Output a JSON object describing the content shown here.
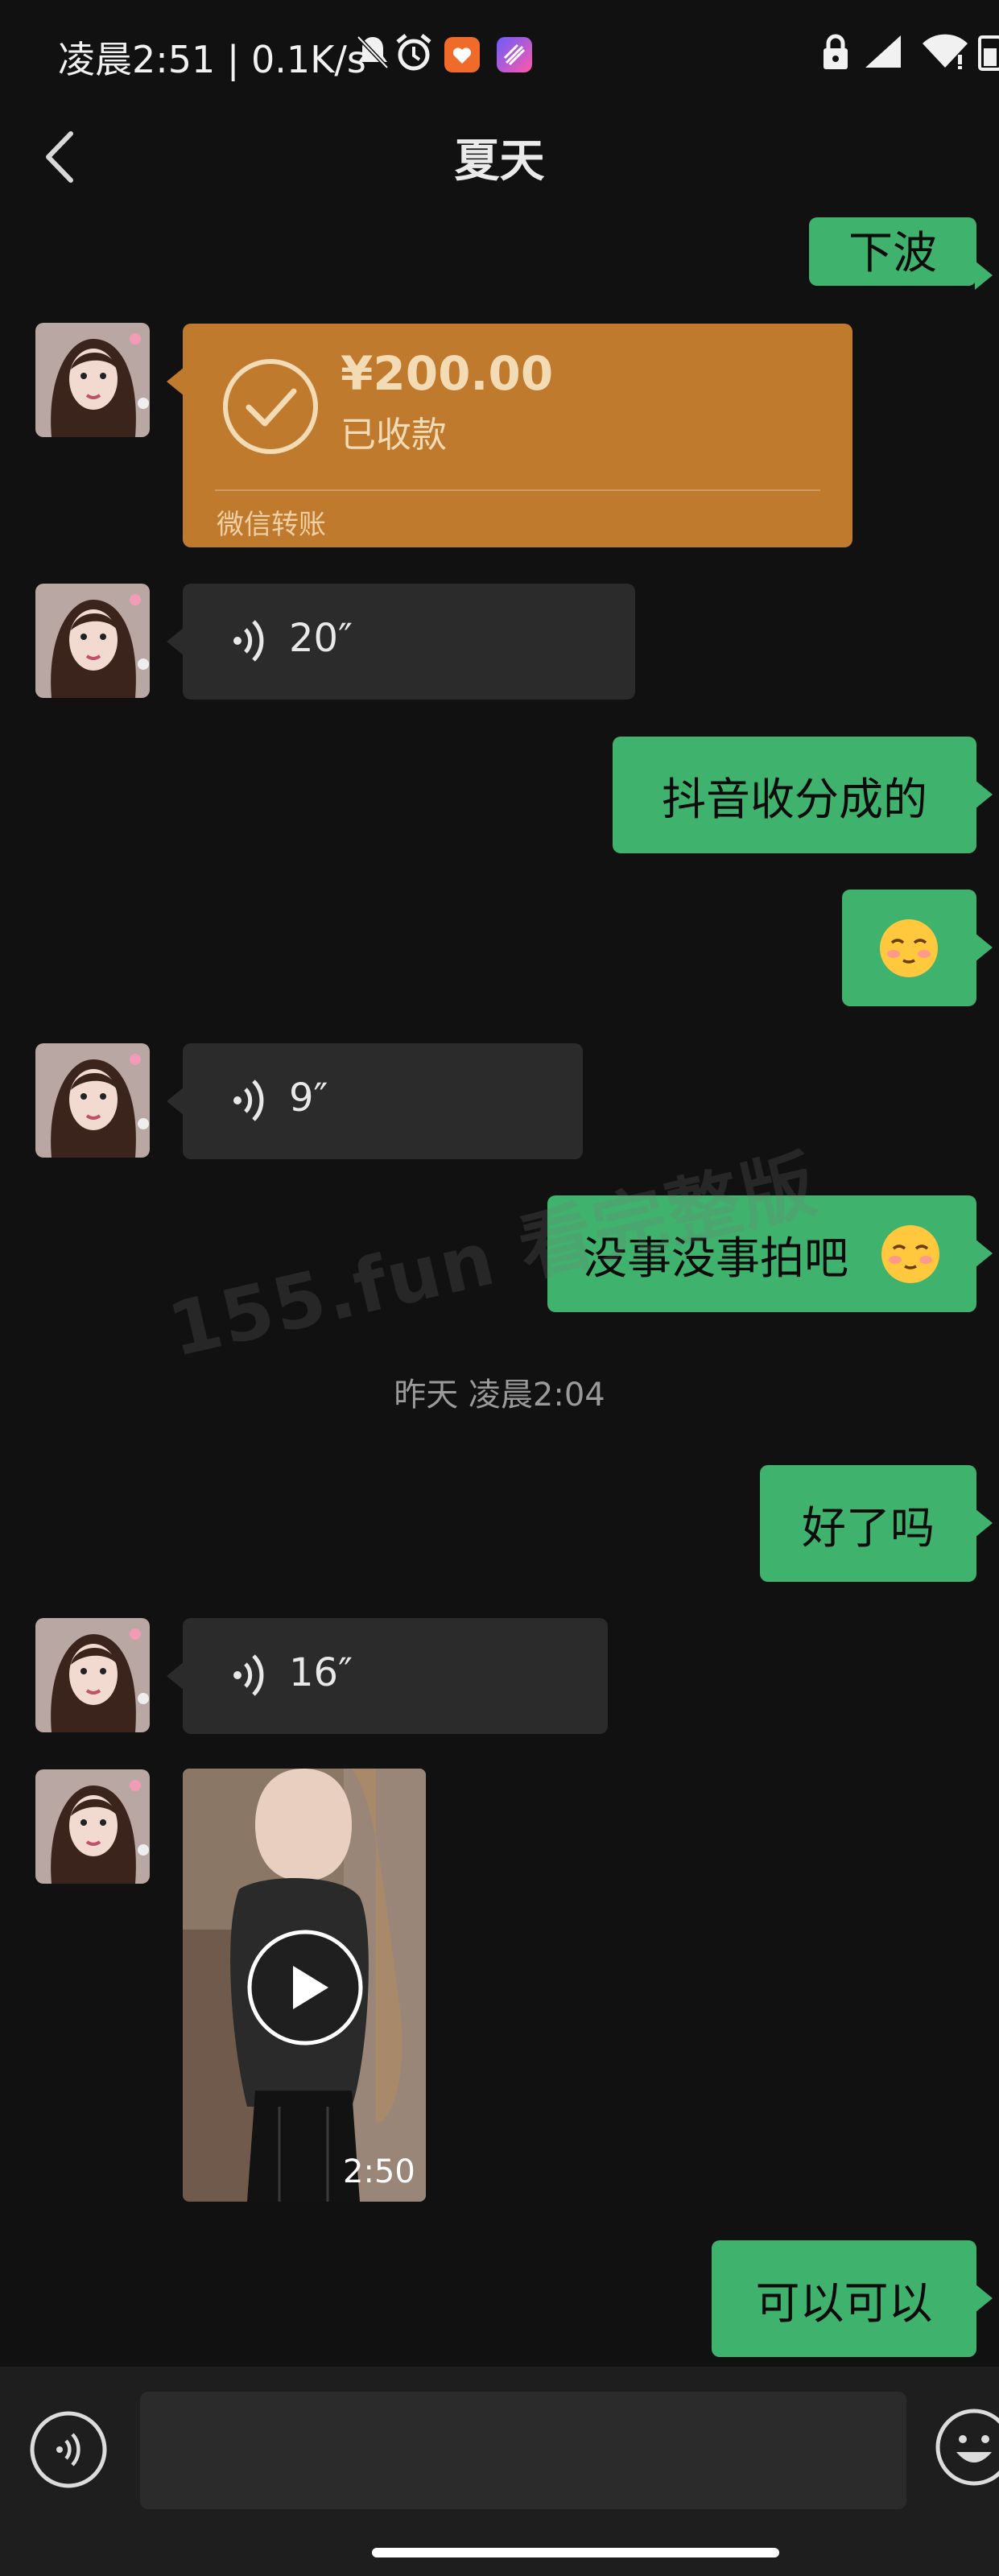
{
  "status_bar": {
    "time_speed": "凌晨2:51 | 0.1K/s"
  },
  "header": {
    "title": "夏天"
  },
  "messages": {
    "m0": {
      "text": "下波"
    },
    "transfer": {
      "amount": "¥200.00",
      "status": "已收款",
      "label": "微信转账"
    },
    "voice1": {
      "duration": "20″"
    },
    "m2": {
      "text": "抖音收分成的"
    },
    "voice2": {
      "duration": "9″"
    },
    "m4": {
      "text": "没事没事拍吧"
    },
    "timestamp": "昨天 凌晨2:04",
    "m5": {
      "text": "好了吗"
    },
    "voice3": {
      "duration": "16″"
    },
    "video": {
      "duration": "2:50"
    },
    "m6": {
      "text": "可以可以"
    }
  },
  "watermark": "155.fun 看完整版",
  "colors": {
    "background": "#111111",
    "outgoing_bubble": "#3fb36e",
    "incoming_bubble": "#2b2b2b",
    "transfer_card": "#c07a2e"
  }
}
